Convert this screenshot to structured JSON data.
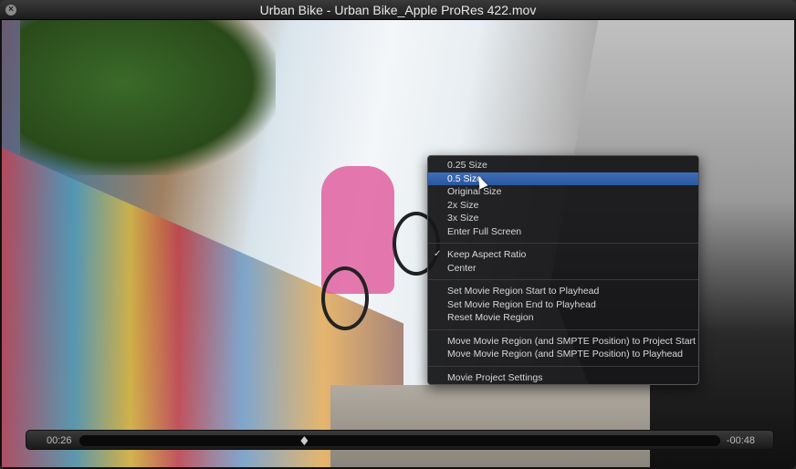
{
  "window": {
    "title": "Urban Bike - Urban Bike_Apple ProRes 422.mov",
    "close_glyph": "×"
  },
  "menu": {
    "groups": [
      [
        {
          "label": "0.25 Size"
        },
        {
          "label": "0.5 Size",
          "selected": true
        },
        {
          "label": "Original Size"
        },
        {
          "label": "2x Size"
        },
        {
          "label": "3x Size"
        },
        {
          "label": "Enter Full Screen"
        }
      ],
      [
        {
          "label": "Keep Aspect Ratio",
          "checked": true
        },
        {
          "label": "Center"
        }
      ],
      [
        {
          "label": "Set Movie Region Start to Playhead"
        },
        {
          "label": "Set Movie Region End to Playhead"
        },
        {
          "label": "Reset Movie Region"
        }
      ],
      [
        {
          "label": "Move Movie Region (and SMPTE Position) to Project Start"
        },
        {
          "label": "Move Movie Region (and SMPTE Position) to Playhead"
        }
      ],
      [
        {
          "label": "Movie Project Settings"
        }
      ]
    ],
    "check_glyph": "✓"
  },
  "controls": {
    "elapsed": "00:26",
    "remaining": "-00:48",
    "progress": 0.351
  }
}
